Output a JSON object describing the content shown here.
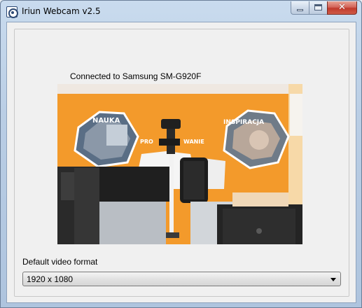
{
  "window": {
    "title": "Iriun Webcam v2.5",
    "app_icon": "webcam-lens-icon",
    "caption_buttons": [
      "minimize",
      "maximize",
      "close"
    ],
    "close_glyph": "✕"
  },
  "status": {
    "text": "Connected to Samsung SM-G920F"
  },
  "preview": {
    "description_icon": "camera-feed",
    "poster_texts": {
      "left": "NAUKA",
      "right": "INSPIRACJA",
      "middle": "PRO",
      "middle2": "WANIE"
    },
    "accent_color": "#f39a2b"
  },
  "video_format": {
    "label": "Default video format",
    "selected": "1920 x 1080"
  }
}
